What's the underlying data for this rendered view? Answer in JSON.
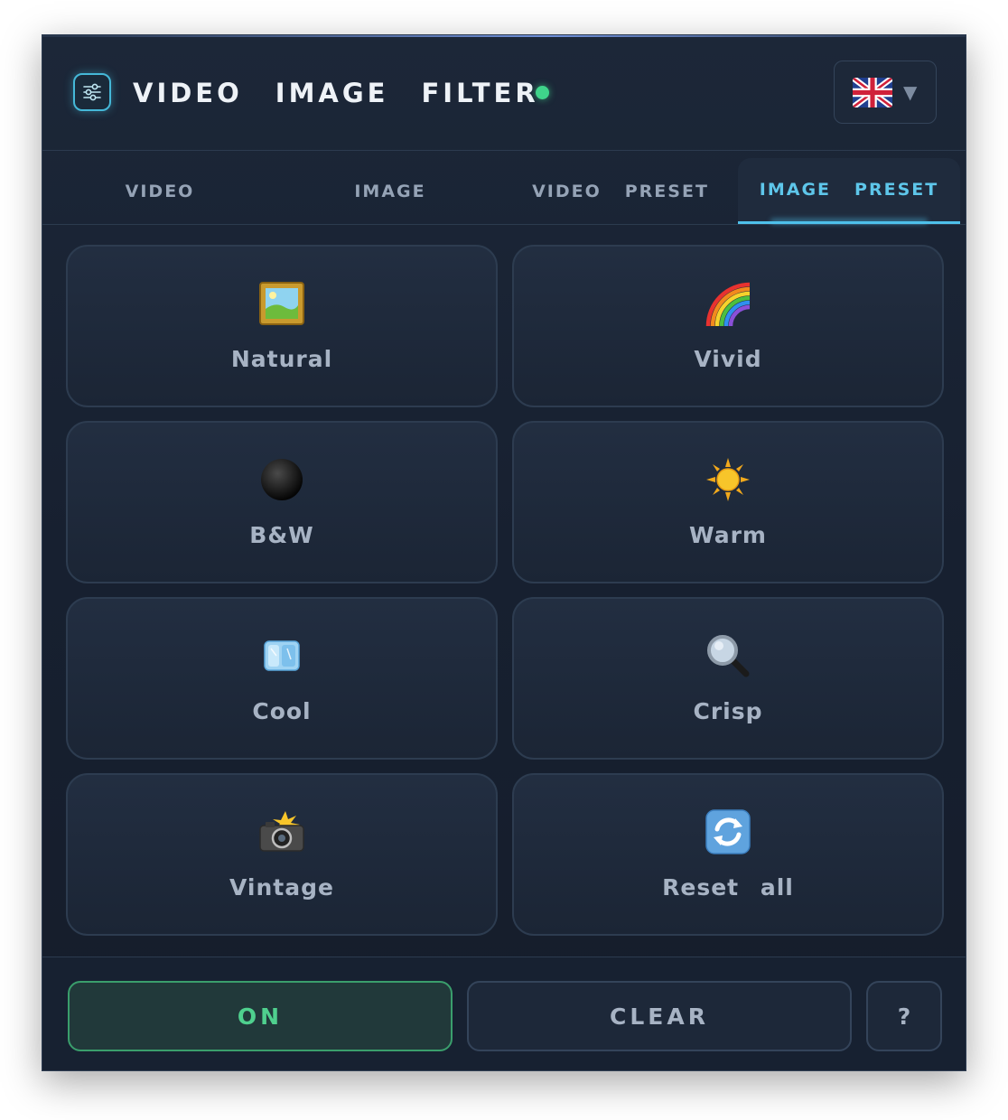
{
  "header": {
    "title_words": [
      "VIDEO",
      "IMAGE",
      "FILTER"
    ],
    "status": "online",
    "status_color": "#3fd48a",
    "logo_icon": "sliders-icon",
    "language": {
      "flag_icon": "uk-flag-icon",
      "caret": "▼"
    }
  },
  "tabs": [
    {
      "words": [
        "VIDEO"
      ],
      "active": false
    },
    {
      "words": [
        "IMAGE"
      ],
      "active": false
    },
    {
      "words": [
        "VIDEO",
        "PRESET"
      ],
      "active": false
    },
    {
      "words": [
        "IMAGE",
        "PRESET"
      ],
      "active": true
    }
  ],
  "presets": [
    {
      "label": "Natural",
      "icon": "framed-picture-icon"
    },
    {
      "label": "Vivid",
      "icon": "rainbow-icon"
    },
    {
      "label": "B&W",
      "icon": "black-circle-icon"
    },
    {
      "label": "Warm",
      "icon": "sun-icon"
    },
    {
      "label": "Cool",
      "icon": "ice-cube-icon"
    },
    {
      "label": "Crisp",
      "icon": "magnifier-icon"
    },
    {
      "label": "Vintage",
      "icon": "camera-flash-icon"
    },
    {
      "label": "Reset all",
      "icon": "refresh-icon"
    }
  ],
  "footer": {
    "on_label": "ON",
    "clear_label": "CLEAR",
    "help_label": "?"
  },
  "colors": {
    "accent": "#4ec0ea",
    "on_green": "#4fd08e",
    "panel_bg": "#182232"
  }
}
